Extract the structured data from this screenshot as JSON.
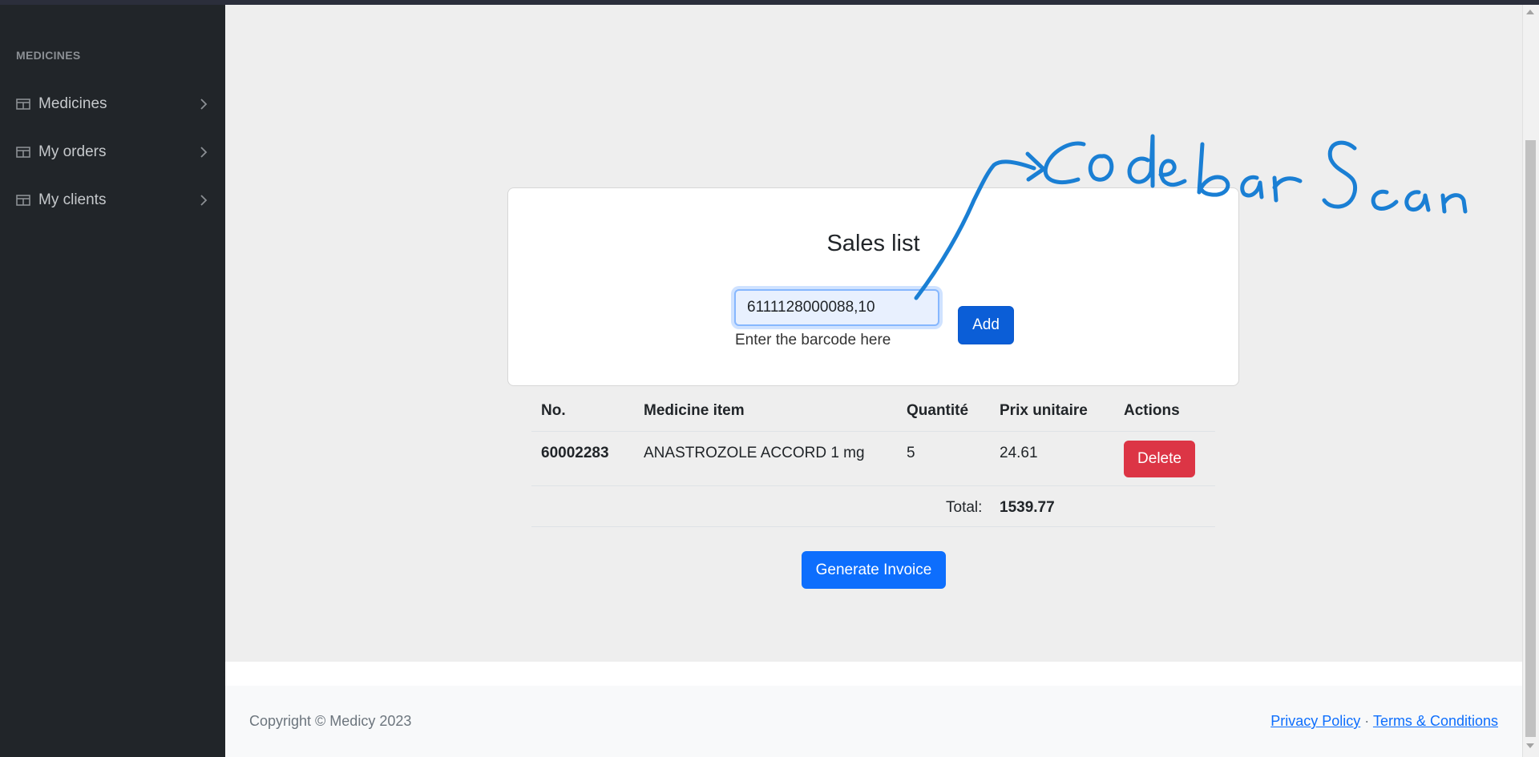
{
  "sidebar": {
    "heading": "MEDICINES",
    "items": [
      {
        "label": "Medicines",
        "icon": "table-icon"
      },
      {
        "label": "My orders",
        "icon": "table-icon"
      },
      {
        "label": "My clients",
        "icon": "table-icon"
      }
    ]
  },
  "sales": {
    "title": "Sales list",
    "barcode_value": "6111128000088,10",
    "barcode_help": "Enter the barcode here",
    "add_label": "Add"
  },
  "table": {
    "headers": [
      "No.",
      "Medicine item",
      "Quantité",
      "Prix unitaire",
      "Actions"
    ],
    "rows": [
      {
        "no": "60002283",
        "item": "ANASTROZOLE ACCORD 1 mg",
        "quantity": "5",
        "unit_price": "24.61",
        "action": "Delete"
      }
    ],
    "total_label": "Total:",
    "total_value": "1539.77"
  },
  "generate_label": "Generate Invoice",
  "stray_text": ";",
  "footer": {
    "copyright": "Copyright © Medicy 2023",
    "privacy": "Privacy Policy",
    "separator": "·",
    "terms": "Terms & Conditions"
  },
  "annotation_text": "Code bar Scan",
  "colors": {
    "sidebar_bg": "#212529",
    "primary": "#0d6efd",
    "danger": "#dc3545",
    "annotation": "#1a7fd4"
  }
}
